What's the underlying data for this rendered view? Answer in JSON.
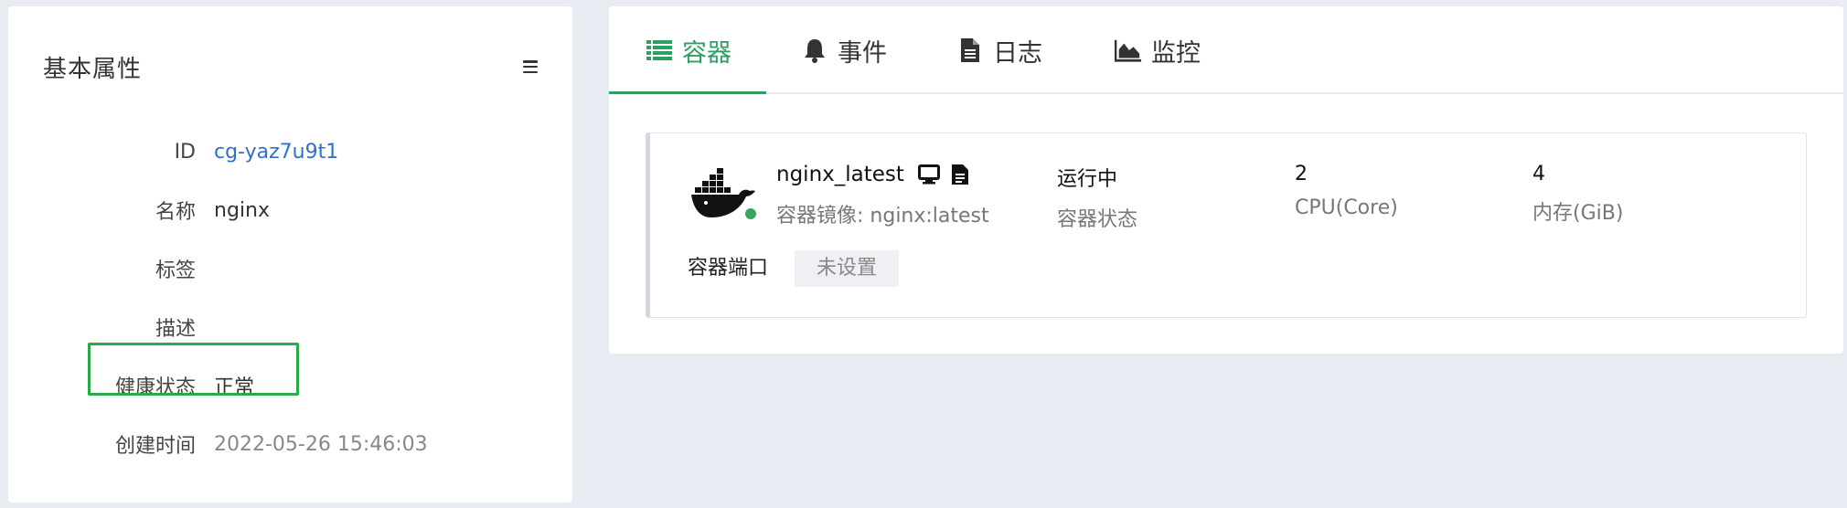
{
  "basic_info": {
    "title": "基本属性",
    "properties": [
      {
        "label": "ID",
        "value": "cg-yaz7u9t1"
      },
      {
        "label": "名称",
        "value": "nginx"
      },
      {
        "label": "标签",
        "value": ""
      },
      {
        "label": "描述",
        "value": ""
      },
      {
        "label": "健康状态",
        "value": "正常"
      },
      {
        "label": "创建时间",
        "value": "2022-05-26 15:46:03"
      }
    ]
  },
  "tabs": [
    {
      "label": "容器",
      "icon": "list-icon",
      "active": true
    },
    {
      "label": "事件",
      "icon": "bell-icon",
      "active": false
    },
    {
      "label": "日志",
      "icon": "document-icon",
      "active": false
    },
    {
      "label": "监控",
      "icon": "area-chart-icon",
      "active": false
    }
  ],
  "container": {
    "name": "nginx_latest",
    "image_line": "容器镜像: nginx:latest",
    "status_value": "运行中",
    "status_label": "容器状态",
    "cpu_value": "2",
    "cpu_label": "CPU(Core)",
    "memory_value": "4",
    "memory_label": "内存(GiB)",
    "port_label": "容器端口",
    "port_value": "未设置",
    "status_color": "#3aa55d"
  },
  "colors": {
    "accent": "#2f9e63",
    "link": "#2e6fd1",
    "highlight_box": "#2aa84a"
  }
}
